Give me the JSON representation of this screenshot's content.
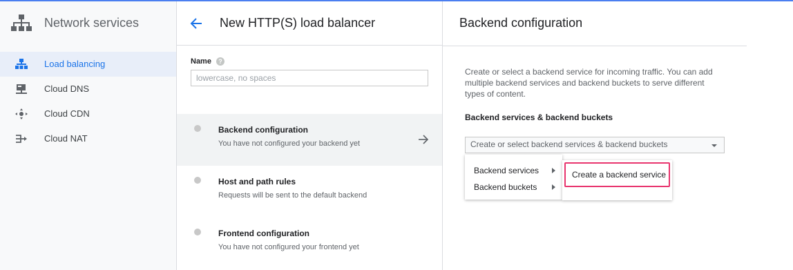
{
  "sidebar": {
    "title": "Network services",
    "logo_icon": "network-services-icon",
    "items": [
      {
        "label": "Load balancing",
        "icon": "load-balancing-icon",
        "active": true
      },
      {
        "label": "Cloud DNS",
        "icon": "cloud-dns-icon",
        "active": false
      },
      {
        "label": "Cloud CDN",
        "icon": "cloud-cdn-icon",
        "active": false
      },
      {
        "label": "Cloud NAT",
        "icon": "cloud-nat-icon",
        "active": false
      }
    ]
  },
  "middle": {
    "title": "New HTTP(S) load balancer",
    "back_icon": "back-arrow-icon",
    "name_label": "Name",
    "name_placeholder": "lowercase, no spaces",
    "name_value": "",
    "steps": [
      {
        "title": "Backend configuration",
        "subtitle": "You have not configured your backend yet",
        "active": true
      },
      {
        "title": "Host and path rules",
        "subtitle": "Requests will be sent to the default backend",
        "active": false
      },
      {
        "title": "Frontend configuration",
        "subtitle": "You have not configured your frontend yet",
        "active": false
      }
    ]
  },
  "right": {
    "title": "Backend configuration",
    "description": "Create or select a backend service for incoming traffic. You can add multiple backend services and backend buckets to serve different types of content.",
    "section_label": "Backend services & backend buckets",
    "select_text": "Create or select backend services & backend buckets",
    "menu_items": [
      "Backend services",
      "Backend buckets"
    ],
    "submenu_item": "Create a backend service"
  },
  "colors": {
    "accent": "#1a73e8",
    "active_bg": "#e8eef9",
    "highlight": "#e8336d",
    "top_bar": "#4a7ef0"
  }
}
